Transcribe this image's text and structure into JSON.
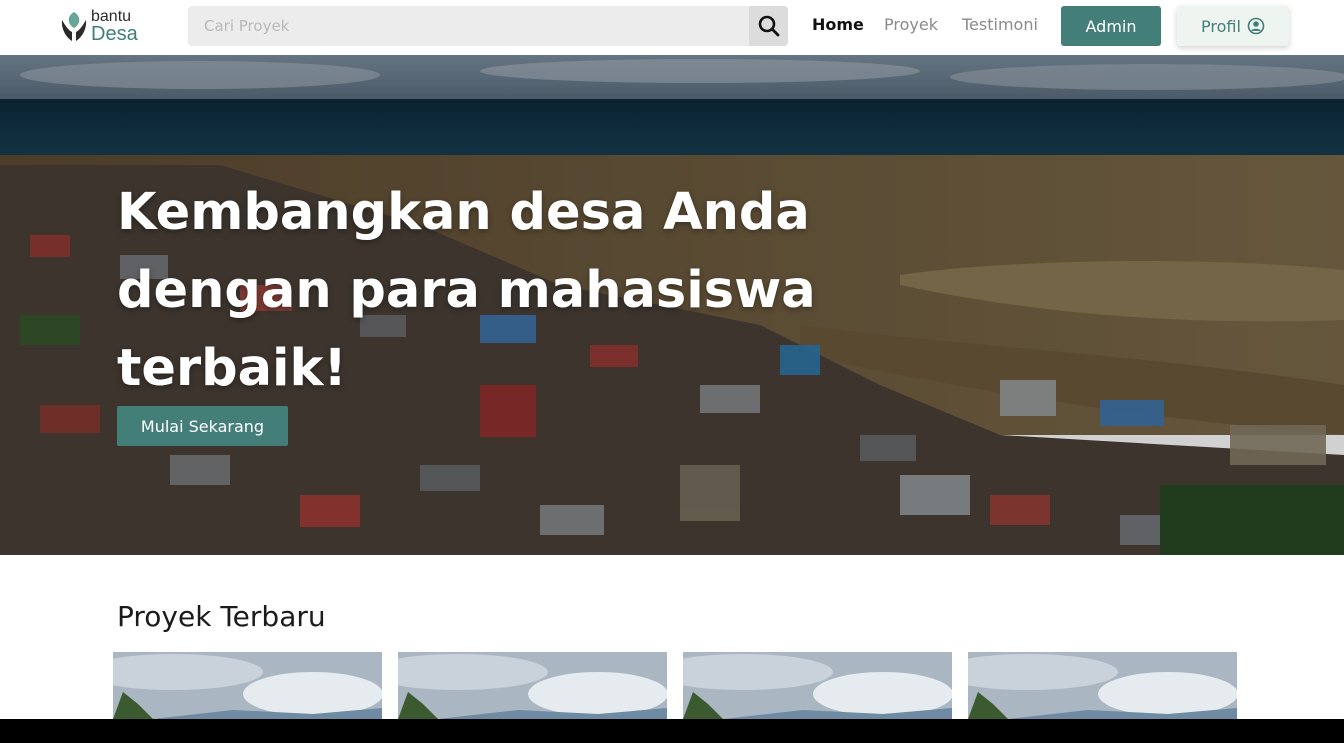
{
  "brand": {
    "line1": "bantu",
    "line2": "Desa"
  },
  "search": {
    "placeholder": "Cari Proyek",
    "value": ""
  },
  "nav": {
    "home": "Home",
    "proyek": "Proyek",
    "testimoni": "Testimoni"
  },
  "buttons": {
    "admin": "Admin",
    "profil": "Profil"
  },
  "hero": {
    "title_line1": "Kembangkan desa Anda",
    "title_line2": "dengan para mahasiswa",
    "title_line3": "terbaik!",
    "cta": "Mulai Sekarang"
  },
  "section": {
    "title": "Proyek Terbaru"
  },
  "icons": {
    "search": "search-icon",
    "profile": "user-circle-icon",
    "logo": "leaf-hands-icon"
  },
  "colors": {
    "primary": "#447e79",
    "logo_green": "#3e7f76",
    "profil_bg": "#eef4ef"
  }
}
